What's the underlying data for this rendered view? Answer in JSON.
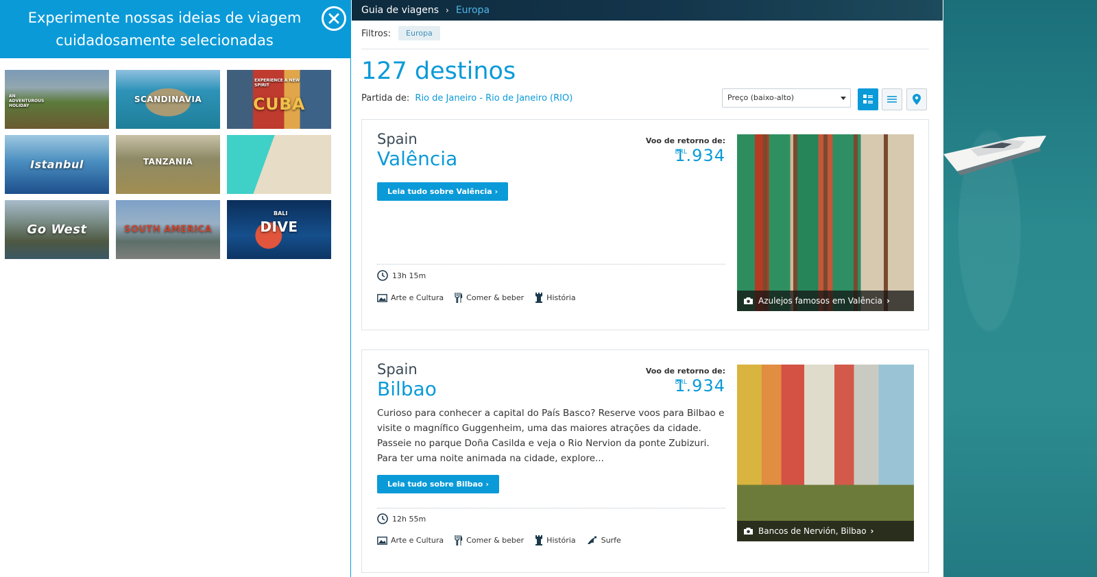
{
  "ideas_panel": {
    "title_line1": "Experimente nossas ideias de viagem",
    "title_line2": "cuidadosamente selecionadas",
    "tiles": [
      {
        "label": "",
        "sub": "AN ADVENTUROUS HOLIDAY"
      },
      {
        "label": "SCANDINAVIA",
        "sub": ""
      },
      {
        "label": "CUBA",
        "sub": "EXPERIENCE A NEW SPIRIT"
      },
      {
        "label": "Istanbul",
        "sub": ""
      },
      {
        "label": "TANZANIA",
        "sub": ""
      },
      {
        "label": "",
        "sub": ""
      },
      {
        "label": "Go West",
        "sub": ""
      },
      {
        "label": "SOUTH AMERICA",
        "sub": ""
      },
      {
        "label": "DIVE",
        "sub": "BALI"
      }
    ]
  },
  "breadcrumb": {
    "root": "Guia de viagens",
    "separator": "›",
    "current": "Europa"
  },
  "filters": {
    "label": "Filtros:",
    "chip": "Europa"
  },
  "results": {
    "count": "127 destinos",
    "departure_label": "Partida de:",
    "departure_city": "Rio de Janeiro - Rio de Janeiro (RIO)",
    "sort_value": "Preço (baixo-alto)"
  },
  "cards": [
    {
      "country": "Spain",
      "city": "Valência",
      "fare_label": "Voo de retorno de:",
      "currency": "BRL",
      "price": "1.934",
      "description": "",
      "cta": "Leia tudo sobre Valência",
      "duration": "13h 15m",
      "tags": [
        "Arte e Cultura",
        "Comer & beber",
        "História"
      ],
      "photo_caption": "Azulejos famosos em Valência"
    },
    {
      "country": "Spain",
      "city": "Bilbao",
      "fare_label": "Voo de retorno de:",
      "currency": "BRL",
      "price": "1.934",
      "description": "Curioso para conhecer a capital do País Basco? Reserve voos para Bilbao e visite o magnífico Guggenheim, uma das maiores atrações da cidade. Passeie no parque Doña Casilda e veja o Rio Nervion da ponte Zubizuri. Para ter uma noite animada na cidade, explore...",
      "cta": "Leia tudo sobre Bilbao",
      "duration": "12h 55m",
      "tags": [
        "Arte e Cultura",
        "Comer & beber",
        "História",
        "Surfe"
      ],
      "photo_caption": "Bancos de Nervión, Bilbao"
    }
  ],
  "icons": {
    "close": "close-icon",
    "camera": "camera-icon",
    "clock": "clock-icon",
    "art": "image-icon",
    "food": "fork-knife-icon",
    "history": "tower-icon",
    "surf": "surf-icon",
    "view_card": "card-view-icon",
    "view_list": "list-view-icon",
    "view_map": "map-pin-icon"
  },
  "colors": {
    "accent": "#0a9ad8",
    "header_dark": "#13344a",
    "sea": "#2a8a8e"
  }
}
